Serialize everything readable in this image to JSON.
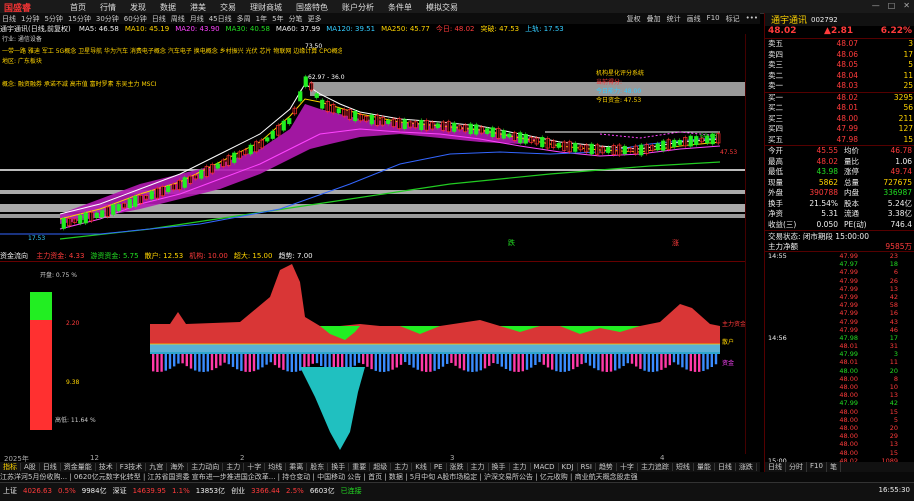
{
  "menubar": {
    "logo": "国盛睿",
    "items": [
      "首页",
      "行情",
      "发现",
      "数据",
      "港美",
      "交易",
      "理财商城",
      "国盛特色",
      "账户分析",
      "条件单",
      "模拟交易"
    ],
    "window_controls": [
      "—",
      "□",
      "✕"
    ]
  },
  "toolbar": {
    "left_items": [
      "日线",
      "1分钟",
      "5分钟",
      "15分钟",
      "30分钟",
      "60分钟",
      "日线",
      "周线",
      "月线",
      "45日线",
      "多周",
      "1年",
      "5年",
      "分笔",
      "更多"
    ],
    "right_items": [
      "复权",
      "叠加",
      "统计",
      "画线",
      "F10",
      "标记",
      "•••"
    ]
  },
  "infobar": {
    "title": "通宇通讯(日线,前复权)",
    "ma_items": [
      {
        "t": "MA5: 46.58",
        "c": "white"
      },
      {
        "t": "MA10: 45.19",
        "c": "yellow"
      },
      {
        "t": "MA20: 43.90",
        "c": "mag"
      },
      {
        "t": "MA30: 40.58",
        "c": "green"
      },
      {
        "t": "MA60: 37.99",
        "c": "white"
      },
      {
        "t": "MA120: 39.51",
        "c": "cyan"
      },
      {
        "t": "MA250: 45.77",
        "c": "yellow"
      },
      {
        "t": "今日: 48.02",
        "c": "red"
      },
      {
        "t": "突破: 47.53",
        "c": "yellow"
      },
      {
        "t": "上轨: 17.53",
        "c": "cyan"
      }
    ]
  },
  "chart": {
    "left_labels": [
      {
        "t": "行业: 通信设备",
        "c": "yellow"
      },
      {
        "t": "地区: 广东板块",
        "c": "yellow"
      },
      {
        "t": "概念: 融资融券 承诺不减 高市值 富时罗素 东吴主力 MSCI",
        "c": "yellow"
      }
    ],
    "concept_line": "一带一路 雅迪 军工 5G概念 卫星导航 华为汽车 消费电子概念 汽车电子 换电概念 乡村振兴 光伏 芯片 物联网 边缘计算 CPO概念 毫米波雷达 6G概念 光通信 低空经济 铜缆高速连接 商业航天",
    "price_high": "73.50",
    "price_mid": "62.97 - 36.0",
    "low_label": "17.53",
    "eval_title": "机构星化评分系统",
    "eval_lines": [
      {
        "t": "当前得分:",
        "c": "red"
      },
      {
        "t": "今日能力:",
        "c": "cyan"
      },
      {
        "t": "今日资金:",
        "c": "yellow"
      }
    ],
    "eval_values": [
      "",
      "48.00",
      "47.53"
    ],
    "right_labels": [
      {
        "t": "60.63",
        "c": "green"
      },
      {
        "t": "47.53",
        "c": "red"
      }
    ],
    "date_labels": [
      "2025年",
      "12",
      "2",
      "3",
      "4"
    ],
    "mark_labels": [
      {
        "t": "跌",
        "c": "green"
      },
      {
        "t": "涨",
        "c": "red"
      }
    ]
  },
  "sub_header": {
    "title": "资金流向",
    "items": [
      {
        "t": "主力资金: 4.33",
        "c": "red"
      },
      {
        "t": "游资资金: 5.75",
        "c": "green"
      },
      {
        "t": "散户: 12.53",
        "c": "yellow"
      },
      {
        "t": "机构: 10.00",
        "c": "red"
      },
      {
        "t": "超大: 15.00",
        "c": "yellow"
      },
      {
        "t": "趋势: 7.00",
        "c": "white"
      }
    ]
  },
  "sub_panel": {
    "open_label": "开盘: 0.75 %",
    "val_top": "2.20",
    "val_mid": "9.38",
    "close_label": "高低: 11.64 %",
    "legend": [
      {
        "t": "主力资金",
        "c": "red"
      },
      {
        "t": "散户",
        "c": "yellow"
      },
      {
        "t": "资金",
        "c": "mag"
      }
    ]
  },
  "bottom_tabs": [
    "指标",
    "A股",
    "日线",
    "资金量能",
    "技术",
    "F3技术",
    "九宫",
    "海外",
    "主力动向",
    "主力",
    "十字",
    "均线",
    "乘离",
    "股东",
    "换手",
    "重要",
    "超级",
    "主力",
    "K线",
    "PE",
    "涨跌",
    "主力",
    "换手",
    "主力",
    "MACD",
    "KDJ",
    "RSI",
    "趋势",
    "十字",
    "主力追踪",
    "短线",
    "量能",
    "日线",
    "涨跌"
  ],
  "news": "江苏洋河5月份收购... | 0620亿元数字化转型 | 江苏省国资委 宣布进一步推进国企改革... | 持仓变动 | 中国移动 公告 | 首页 | 数据 | 5月中旬 A股市场稳定 | 沪深交易所公告 | 亿元收购 | 商业航天概念股走强",
  "status": {
    "items": [
      {
        "t": "上证",
        "c": "white"
      },
      {
        "t": "4026.63",
        "c": "red"
      },
      {
        "t": "0.5%",
        "c": "red"
      },
      {
        "t": "9984亿",
        "c": "white"
      },
      {
        "t": "深证",
        "c": "white"
      },
      {
        "t": "14639.95",
        "c": "red"
      },
      {
        "t": "1.1%",
        "c": "red"
      },
      {
        "t": "13853亿",
        "c": "white"
      },
      {
        "t": "创业",
        "c": "white"
      },
      {
        "t": "3366.44",
        "c": "red"
      },
      {
        "t": "2.5%",
        "c": "red"
      },
      {
        "t": "6603亿",
        "c": "white"
      },
      {
        "t": "已连接",
        "c": "green"
      }
    ],
    "time": "16:55:30"
  },
  "panel": {
    "stock_name": "通宇通讯",
    "stock_code": "002792",
    "price": "48.02",
    "change": "2.81",
    "pct": "6.22%",
    "sells": [
      {
        "label": "卖五",
        "price": "48.07",
        "vol": "3"
      },
      {
        "label": "卖四",
        "price": "48.06",
        "vol": "17"
      },
      {
        "label": "卖三",
        "price": "48.05",
        "vol": "5"
      },
      {
        "label": "卖二",
        "price": "48.04",
        "vol": "11"
      },
      {
        "label": "卖一",
        "price": "48.03",
        "vol": "25"
      }
    ],
    "buys": [
      {
        "label": "买一",
        "price": "48.02",
        "vol": "3295"
      },
      {
        "label": "买二",
        "price": "48.01",
        "vol": "56"
      },
      {
        "label": "买三",
        "price": "48.00",
        "vol": "211"
      },
      {
        "label": "买四",
        "price": "47.99",
        "vol": "127"
      },
      {
        "label": "买五",
        "price": "47.98",
        "vol": "15"
      }
    ],
    "stats": [
      {
        "l1": "今开",
        "v1": "45.55",
        "c1": "red",
        "l2": "均价",
        "v2": "46.78",
        "c2": "red"
      },
      {
        "l1": "最高",
        "v1": "48.02",
        "c1": "red",
        "l2": "量比",
        "v2": "1.06",
        "c2": "white"
      },
      {
        "l1": "最低",
        "v1": "43.98",
        "c1": "green",
        "l2": "涨停",
        "v2": "49.74",
        "c2": "red"
      },
      {
        "l1": "现量",
        "v1": "5862",
        "c1": "yellow",
        "l2": "总量",
        "v2": "727675",
        "c2": "yellow"
      },
      {
        "l1": "外盘",
        "v1": "390788",
        "c1": "red",
        "l2": "内盘",
        "v2": "336987",
        "c2": "green"
      },
      {
        "l1": "换手",
        "v1": "21.54%",
        "c1": "white",
        "l2": "股本",
        "v2": "5.24亿",
        "c2": "white"
      },
      {
        "l1": "净资",
        "v1": "5.31",
        "c1": "white",
        "l2": "流通",
        "v2": "3.38亿",
        "c2": "white"
      },
      {
        "l1": "收益(三)",
        "v1": "0.050",
        "c1": "white",
        "l2": "PE(动)",
        "v2": "746.4",
        "c2": "white"
      }
    ],
    "trade_status": "交易状态: 闭市期段 15:00:00",
    "main_flow_label": "主力净额",
    "main_flow_value": "9585万",
    "ticks": [
      {
        "time": "14:55",
        "price": "47.99",
        "vol": "23",
        "c": "red"
      },
      {
        "time": "",
        "price": "47.97",
        "vol": "18",
        "c": "green"
      },
      {
        "time": "",
        "price": "47.99",
        "vol": "6",
        "c": "red"
      },
      {
        "time": "",
        "price": "47.99",
        "vol": "26",
        "c": "red"
      },
      {
        "time": "",
        "price": "47.99",
        "vol": "13",
        "c": "red"
      },
      {
        "time": "",
        "price": "47.99",
        "vol": "42",
        "c": "red"
      },
      {
        "time": "",
        "price": "47.99",
        "vol": "58",
        "c": "red"
      },
      {
        "time": "",
        "price": "47.99",
        "vol": "16",
        "c": "red"
      },
      {
        "time": "",
        "price": "47.99",
        "vol": "43",
        "c": "red"
      },
      {
        "time": "",
        "price": "47.99",
        "vol": "46",
        "c": "red"
      },
      {
        "time": "14:56",
        "price": "47.98",
        "vol": "17",
        "c": "green"
      },
      {
        "time": "",
        "price": "48.01",
        "vol": "31",
        "c": "red"
      },
      {
        "time": "",
        "price": "47.99",
        "vol": "3",
        "c": "green"
      },
      {
        "time": "",
        "price": "48.01",
        "vol": "11",
        "c": "red"
      },
      {
        "time": "",
        "price": "48.00",
        "vol": "20",
        "c": "green"
      },
      {
        "time": "",
        "price": "48.00",
        "vol": "8",
        "c": "red"
      },
      {
        "time": "",
        "price": "48.00",
        "vol": "10",
        "c": "red"
      },
      {
        "time": "",
        "price": "48.00",
        "vol": "13",
        "c": "red"
      },
      {
        "time": "",
        "price": "47.99",
        "vol": "42",
        "c": "green"
      },
      {
        "time": "",
        "price": "48.00",
        "vol": "15",
        "c": "red"
      },
      {
        "time": "",
        "price": "48.00",
        "vol": "5",
        "c": "red"
      },
      {
        "time": "",
        "price": "48.00",
        "vol": "20",
        "c": "red"
      },
      {
        "time": "",
        "price": "48.00",
        "vol": "29",
        "c": "red"
      },
      {
        "time": "",
        "price": "48.00",
        "vol": "13",
        "c": "red"
      },
      {
        "time": "",
        "price": "48.00",
        "vol": "15",
        "c": "red"
      },
      {
        "time": "15:00",
        "price": "48.02",
        "vol": "1089",
        "c": "red"
      }
    ],
    "tabs": [
      "日线",
      "分时",
      "F10",
      "笔"
    ]
  }
}
